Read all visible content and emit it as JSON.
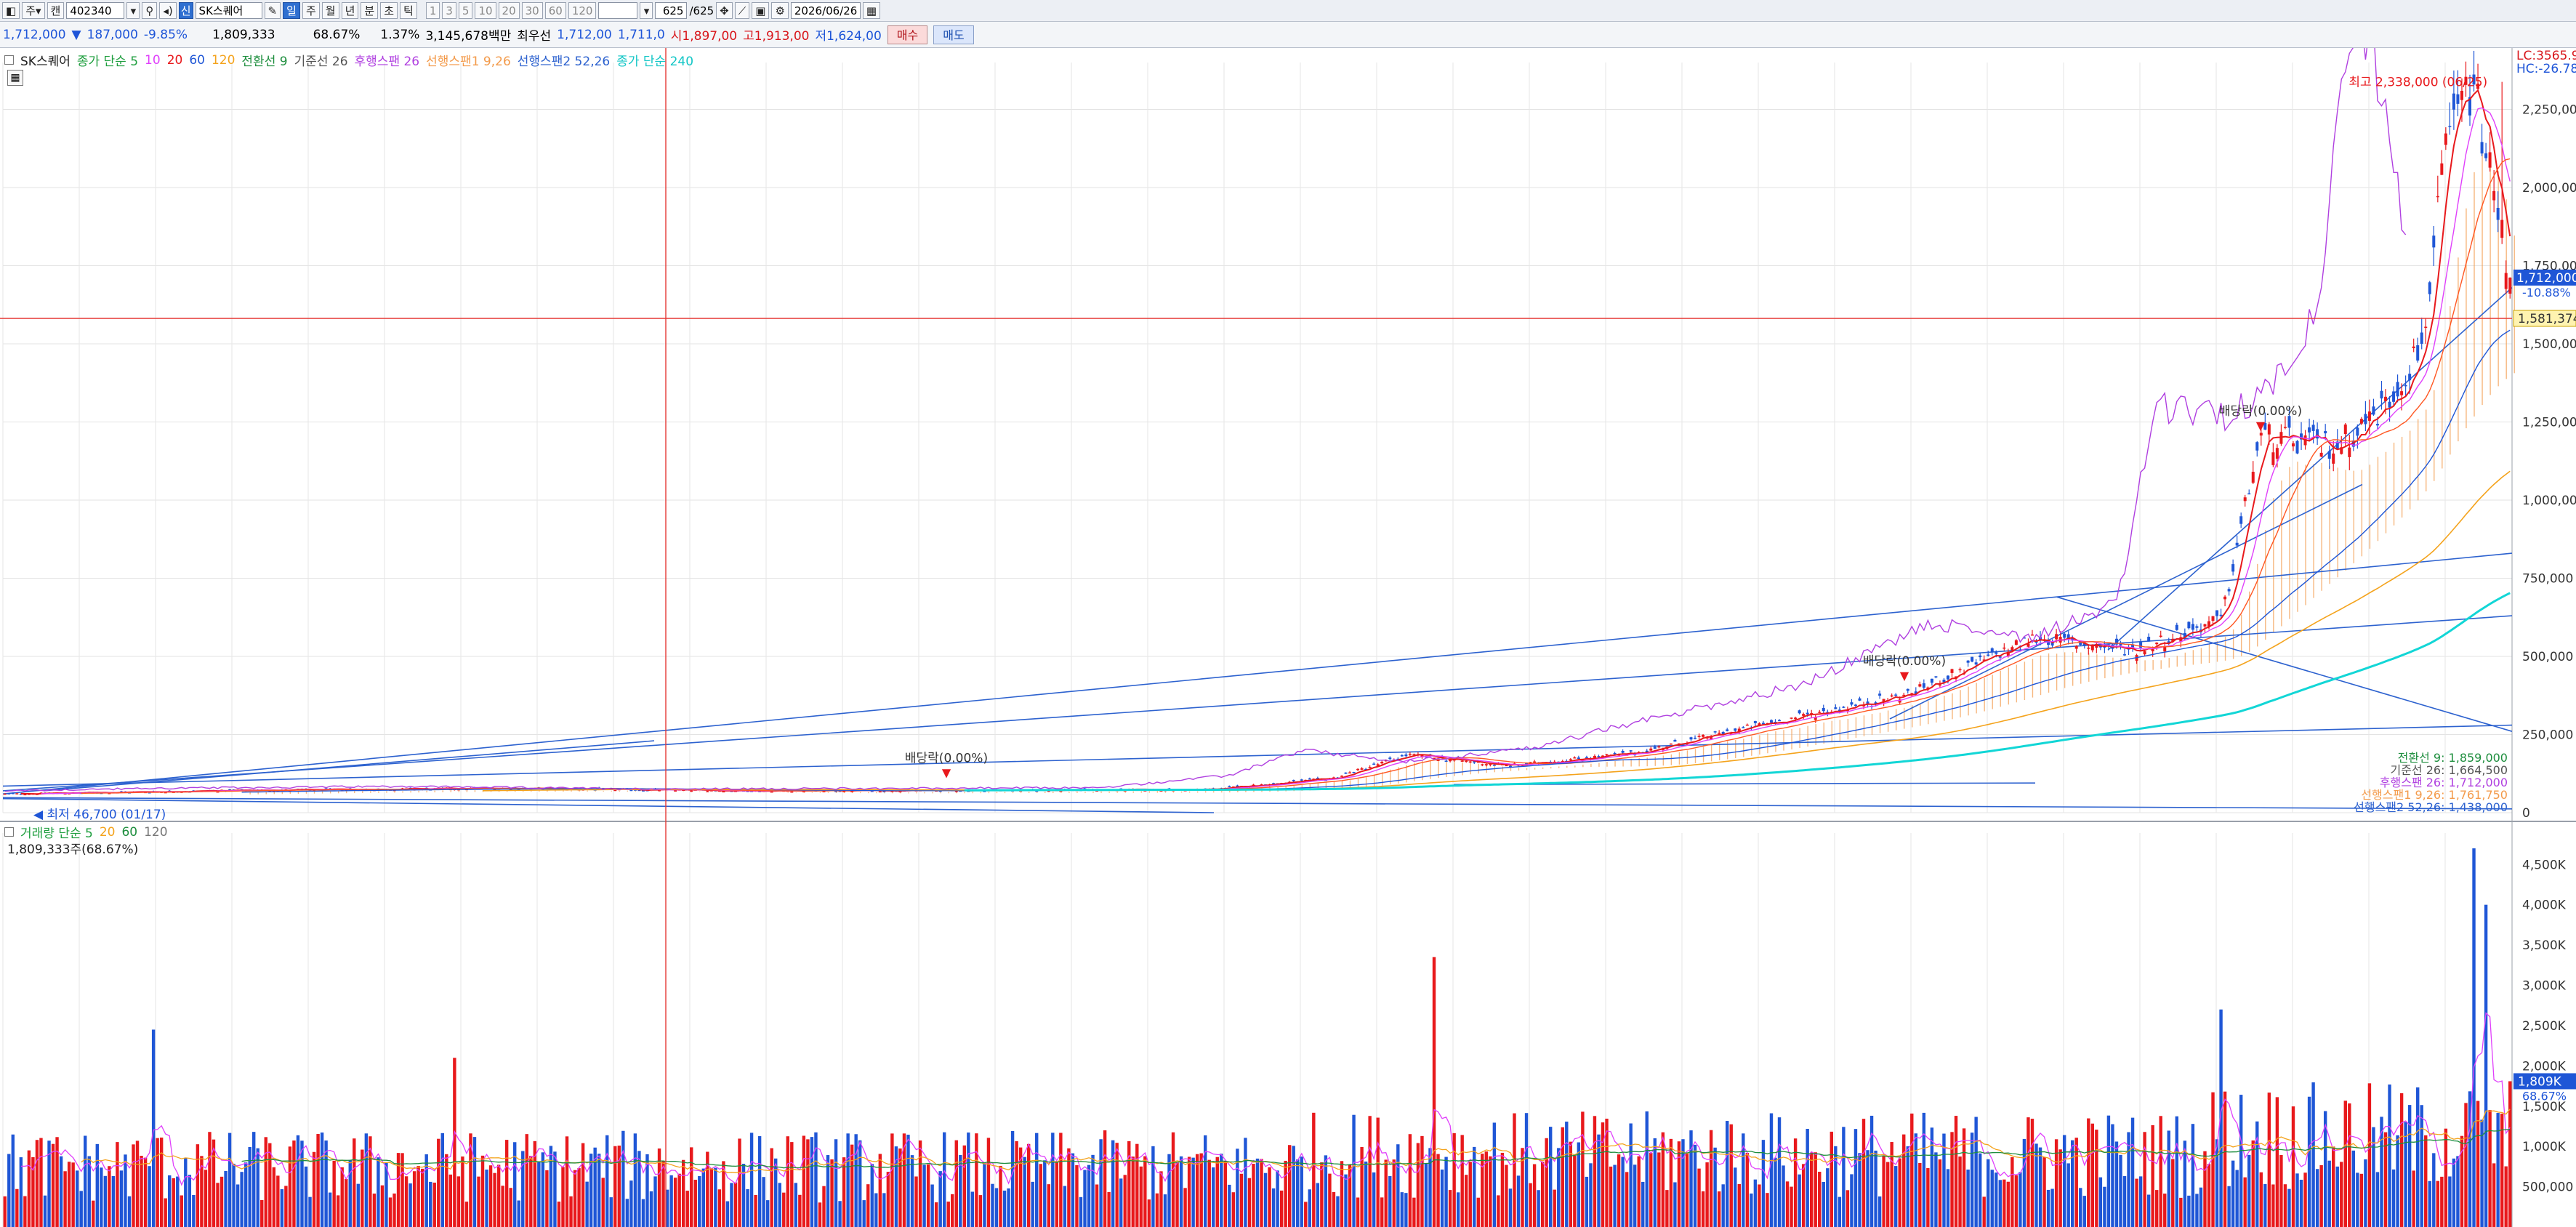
{
  "toolbar": {
    "period_label": "주",
    "view_label": "캔",
    "code": "402340",
    "stock_badge": "신",
    "stock_name": "SK스퀘어",
    "periods": [
      "일",
      "주",
      "월",
      "년",
      "분",
      "초",
      "틱"
    ],
    "active_period_index": 0,
    "minute_options": [
      "1",
      "3",
      "5",
      "10",
      "20",
      "30",
      "60",
      "120"
    ],
    "count": "625",
    "count_total": "/625",
    "date": "2026/06/26"
  },
  "info": {
    "price": "1,712,000",
    "change_arrow": "▼",
    "change": "187,000",
    "change_pct": "-9.85%",
    "volume": "1,809,333",
    "volume_ratio": "68.67%",
    "turnover_pct": "1.37%",
    "amount": "3,145,678백만",
    "prior_label": "최우선",
    "prior_ask": "1,712,00",
    "prior_bid": "1,711,0",
    "open": "시1,897,00",
    "high": "고1,913,00",
    "low": "저1,624,00",
    "buy_label": "매수",
    "sell_label": "매도"
  },
  "price_legend": {
    "stock": "SK스퀘어",
    "ma_label": "종가 단순 5",
    "ma_periods": [
      "10",
      "20",
      "60",
      "120"
    ],
    "conversion": "전환선 9",
    "base": "기준선 26",
    "lagging": "후행스팬 26",
    "span1": "선행스팬1 9,26",
    "span2": "선행스팬2 52,26",
    "ma240": "종가 단순 240"
  },
  "volume_legend": {
    "title": "거래량 단순 5",
    "periods": [
      "20",
      "60",
      "120"
    ],
    "current": "1,809,333주(68.67%)"
  },
  "annotations": {
    "high": "최고 2,338,000 (06/25)",
    "low": "최저 46,700 (01/17)",
    "dividend1": "배당락(0.00%)",
    "dividend2": "배당락(0.00%)",
    "dividend3": "배당락(0.00%)"
  },
  "right_labels": {
    "lc": "LC:3565.9",
    "hc": "HC:-26.78",
    "current_price": "1,712,000",
    "current_pct": "-10.88%",
    "crosshair_price": "1,581,374",
    "volume_current": "1,809K",
    "volume_pct": "68.67%"
  },
  "ichimoku_values": {
    "conversion": "전환선 9: 1,859,000",
    "base": "기준선 26: 1,664,500",
    "lagging": "후행스팬 26: 1,712,000",
    "span1": "선행스팬1 9,26: 1,761,750",
    "span2": "선행스팬2 52,26: 1,438,000"
  },
  "colors": {
    "up": "#e8191c",
    "down": "#1f56d6",
    "ma5": "#e8191c",
    "ma10": "#e040fb",
    "ma20": "#ff5722",
    "ma60": "#1e8e3e",
    "ma120": "#f4a31c",
    "ma240": "#12d6d6",
    "lagging": "#b040e0",
    "cloud": "#f39a4a",
    "crosshair": "#e53935",
    "trendline": "#2d62cf"
  },
  "chart_data": [
    {
      "type": "candlestick",
      "title": "SK스퀘어",
      "y_axis_ticks": [
        "2,250,000",
        "2,000,000",
        "1,750,000",
        "1,500,000",
        "1,250,000",
        "1,000,000",
        "750,000",
        "500,000",
        "250,000",
        "0"
      ],
      "ylim": [
        0,
        2338000
      ],
      "ma_series": [
        "5",
        "10",
        "20",
        "60",
        "120",
        "240"
      ],
      "close_anchors": [
        {
          "t": 0.0,
          "v": 60000
        },
        {
          "t": 0.1,
          "v": 72000
        },
        {
          "t": 0.2,
          "v": 78000
        },
        {
          "t": 0.3,
          "v": 70000
        },
        {
          "t": 0.4,
          "v": 72000
        },
        {
          "t": 0.48,
          "v": 74000
        },
        {
          "t": 0.53,
          "v": 110000
        },
        {
          "t": 0.56,
          "v": 185000
        },
        {
          "t": 0.6,
          "v": 150000
        },
        {
          "t": 0.65,
          "v": 190000
        },
        {
          "t": 0.7,
          "v": 280000
        },
        {
          "t": 0.76,
          "v": 380000
        },
        {
          "t": 0.81,
          "v": 560000
        },
        {
          "t": 0.85,
          "v": 520000
        },
        {
          "t": 0.885,
          "v": 620000
        },
        {
          "t": 0.9,
          "v": 1200000
        },
        {
          "t": 0.93,
          "v": 1170000
        },
        {
          "t": 0.95,
          "v": 1300000
        },
        {
          "t": 0.965,
          "v": 1500000
        },
        {
          "t": 0.975,
          "v": 2150000
        },
        {
          "t": 0.985,
          "v": 2338000
        },
        {
          "t": 1.0,
          "v": 1712000
        }
      ],
      "annotation_points": {
        "high_value": 2338000,
        "low_value": 46700
      }
    },
    {
      "type": "bar",
      "title": "거래량",
      "y_axis_ticks": [
        "4,500K",
        "4,000K",
        "3,500K",
        "3,000K",
        "2,500K",
        "2,000K",
        "1,500K",
        "1,000K",
        "500,000"
      ],
      "ylim": [
        0,
        4700000
      ],
      "spikes": [
        {
          "t": 0.06,
          "v": 2450000
        },
        {
          "t": 0.18,
          "v": 2100000
        },
        {
          "t": 0.57,
          "v": 3350000
        },
        {
          "t": 0.885,
          "v": 2700000
        },
        {
          "t": 0.985,
          "v": 4700000
        },
        {
          "t": 0.99,
          "v": 4000000
        }
      ],
      "last_value": 1809333
    }
  ]
}
